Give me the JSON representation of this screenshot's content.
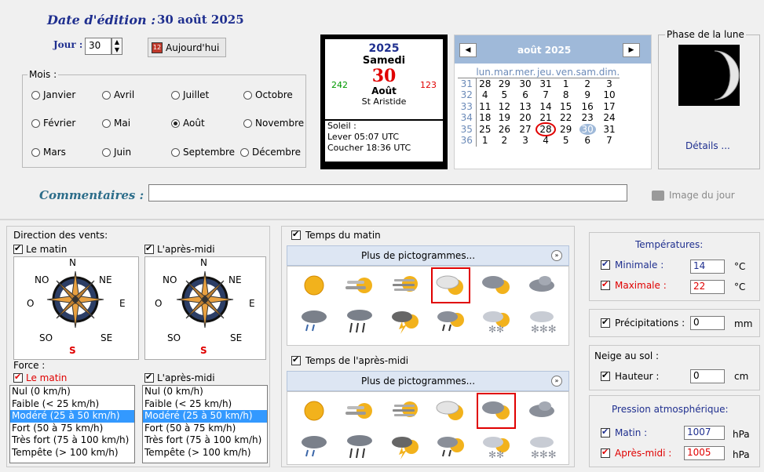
{
  "edition": {
    "label": "Date d'édition :",
    "value": "30 août 2025"
  },
  "day": {
    "label": "Jour :",
    "value": "30",
    "today_button": "Aujourd'hui"
  },
  "months": {
    "title": "Mois :",
    "items": [
      "Janvier",
      "Avril",
      "Juillet",
      "Octobre",
      "Février",
      "Mai",
      "Août",
      "Novembre",
      "Mars",
      "Juin",
      "Septembre",
      "Décembre"
    ],
    "selected": "Août"
  },
  "daycard": {
    "year": "2025",
    "weekday": "Samedi",
    "day": "30",
    "left_num": "242",
    "right_num": "123",
    "month": "Août",
    "saint": "St Aristide",
    "sun_title": "Soleil :",
    "sunrise": "Lever 05:07 UTC",
    "sunset": "Coucher 18:36 UTC"
  },
  "calendar": {
    "title": "août 2025",
    "weekdays": [
      "lun.",
      "mar.",
      "mer.",
      "jeu.",
      "ven.",
      "sam.",
      "dim."
    ],
    "weeks": [
      {
        "n": "31",
        "d": [
          "28",
          "29",
          "30",
          "31",
          "1",
          "2",
          "3"
        ]
      },
      {
        "n": "32",
        "d": [
          "4",
          "5",
          "6",
          "7",
          "8",
          "9",
          "10"
        ]
      },
      {
        "n": "33",
        "d": [
          "11",
          "12",
          "13",
          "14",
          "15",
          "16",
          "17"
        ]
      },
      {
        "n": "34",
        "d": [
          "18",
          "19",
          "20",
          "21",
          "22",
          "23",
          "24"
        ]
      },
      {
        "n": "35",
        "d": [
          "25",
          "26",
          "27",
          "28",
          "29",
          "30",
          "31"
        ]
      },
      {
        "n": "36",
        "d": [
          "1",
          "2",
          "3",
          "4",
          "5",
          "6",
          "7"
        ]
      }
    ]
  },
  "moon": {
    "title": "Phase de la lune",
    "details": "Détails ..."
  },
  "comments": {
    "label": "Commentaires :",
    "value": "",
    "image_label": "Image du jour"
  },
  "winds": {
    "title": "Direction des vents:",
    "morning": "Le matin",
    "afternoon": "L'après-midi",
    "compass": {
      "n": "N",
      "ne": "NE",
      "no": "NO",
      "e": "E",
      "o": "O",
      "se": "SE",
      "so": "SO",
      "s": "S"
    }
  },
  "force": {
    "title": "Force :",
    "morning": "Le matin",
    "afternoon": "L'après-midi",
    "options": [
      "Nul (0 km/h)",
      "Faible (< 25 km/h)",
      "Modéré (25 à 50 km/h)",
      "Fort (50 à 75 km/h)",
      "Très fort (75 à 100 km/h)",
      "Tempête (> 100 km/h)"
    ],
    "selected": "Modéré (25 à 50 km/h)"
  },
  "weather_morning": {
    "title": "Temps du matin",
    "more": "Plus de pictogrammes...",
    "selected_index": 3
  },
  "weather_afternoon": {
    "title": "Temps de l'après-midi",
    "more": "Plus de pictogrammes...",
    "selected_index": 4
  },
  "temps": {
    "title": "Températures:",
    "min_label": "Minimale :",
    "min": "14",
    "max_label": "Maximale :",
    "max": "22",
    "unit": "°C"
  },
  "precip": {
    "label": "Précipitations :",
    "value": "0",
    "unit": "mm"
  },
  "snow": {
    "title": "Neige au sol :",
    "label": "Hauteur :",
    "value": "0",
    "unit": "cm"
  },
  "pressure": {
    "title": "Pression atmosphérique:",
    "morning_label": "Matin :",
    "morning": "1007",
    "afternoon_label": "Après-midi :",
    "afternoon": "1005",
    "unit": "hPa"
  },
  "colors": {
    "accent": "#1f2f8f",
    "red": "#e00000",
    "selection": "#3399ff",
    "calendar_header": "#9fb9d9"
  }
}
